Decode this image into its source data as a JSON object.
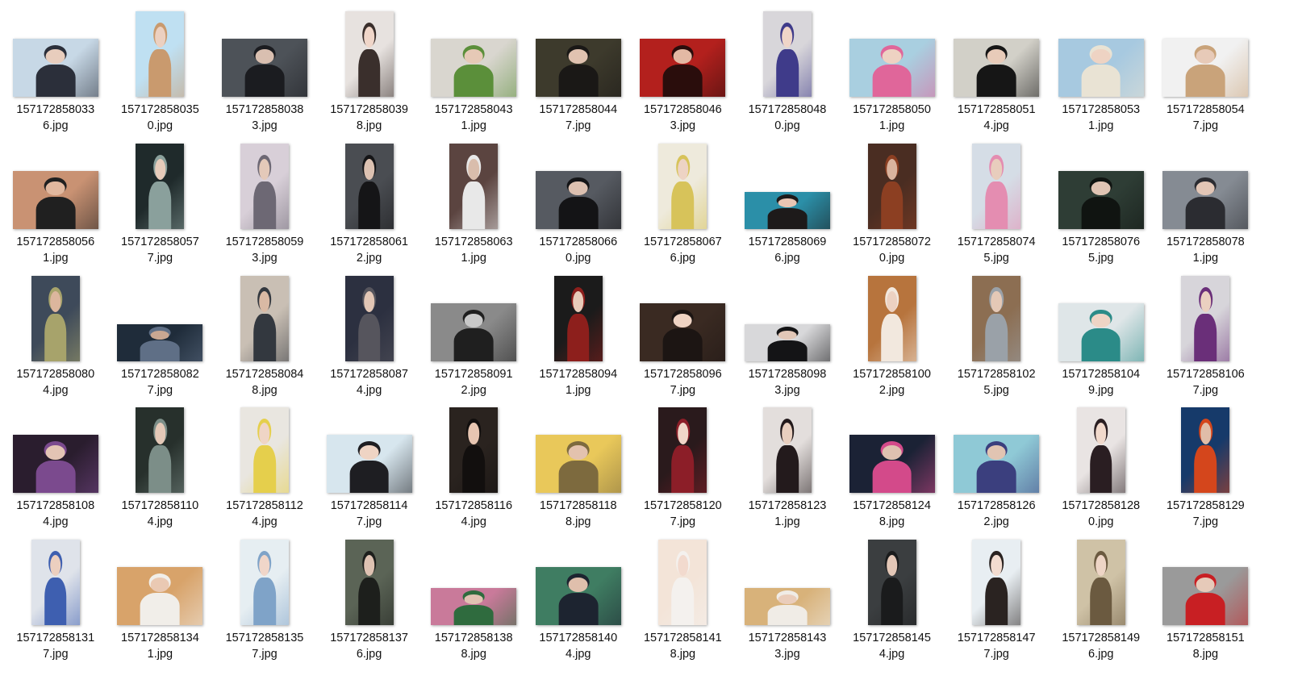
{
  "files": [
    {
      "name_line1": "157172858033",
      "name_line2": "6.jpg",
      "orient": "land",
      "bg": "#c7d8e6",
      "fg": "#2b2f3a",
      "skin": "#e8cdbd"
    },
    {
      "name_line1": "157172858035",
      "name_line2": "0.jpg",
      "orient": "port",
      "bg": "#bfe0f2",
      "fg": "#c99a6e",
      "skin": "#ecd0c0"
    },
    {
      "name_line1": "157172858038",
      "name_line2": "3.jpg",
      "orient": "land",
      "bg": "#4d5258",
      "fg": "#1b1c20",
      "skin": "#d9bfb0"
    },
    {
      "name_line1": "157172858039",
      "name_line2": "8.jpg",
      "orient": "port",
      "bg": "#e7e2df",
      "fg": "#3a2f2c",
      "skin": "#f0d6c9"
    },
    {
      "name_line1": "157172858043",
      "name_line2": "1.jpg",
      "orient": "land",
      "bg": "#d9d6cf",
      "fg": "#5b8f3a",
      "skin": "#e6c9b6"
    },
    {
      "name_line1": "157172858044",
      "name_line2": "7.jpg",
      "orient": "land",
      "bg": "#3d3a2c",
      "fg": "#1a1816",
      "skin": "#e0c2b0"
    },
    {
      "name_line1": "157172858046",
      "name_line2": "3.jpg",
      "orient": "land",
      "bg": "#b3201d",
      "fg": "#2a0d0c",
      "skin": "#e3b9a4"
    },
    {
      "name_line1": "157172858048",
      "name_line2": "0.jpg",
      "orient": "port",
      "bg": "#d8d6da",
      "fg": "#3f3b8a",
      "skin": "#efd5c8"
    },
    {
      "name_line1": "157172858050",
      "name_line2": "1.jpg",
      "orient": "land",
      "bg": "#a9cfe0",
      "fg": "#e0669a",
      "skin": "#eed2c2"
    },
    {
      "name_line1": "157172858051",
      "name_line2": "4.jpg",
      "orient": "land",
      "bg": "#d2d0c8",
      "fg": "#161616",
      "skin": "#e8cbb9"
    },
    {
      "name_line1": "157172858053",
      "name_line2": "1.jpg",
      "orient": "land",
      "bg": "#a7c9e0",
      "fg": "#e9e3d4",
      "skin": "#eed3c3"
    },
    {
      "name_line1": "157172858054",
      "name_line2": "7.jpg",
      "orient": "land",
      "bg": "#f1f1f1",
      "fg": "#c9a37a",
      "skin": "#e7cab8"
    },
    {
      "name_line1": "157172858056",
      "name_line2": "1.jpg",
      "orient": "land",
      "bg": "#c99273",
      "fg": "#202020",
      "skin": "#e1b89f"
    },
    {
      "name_line1": "157172858057",
      "name_line2": "7.jpg",
      "orient": "port",
      "bg": "#1f2a2b",
      "fg": "#8aa09c",
      "skin": "#e6cbba"
    },
    {
      "name_line1": "157172858059",
      "name_line2": "3.jpg",
      "orient": "port",
      "bg": "#d8cfd8",
      "fg": "#6d6874",
      "skin": "#e4c9b9"
    },
    {
      "name_line1": "157172858061",
      "name_line2": "2.jpg",
      "orient": "port",
      "bg": "#4a4d52",
      "fg": "#151517",
      "skin": "#dcc1b1"
    },
    {
      "name_line1": "157172858063",
      "name_line2": "1.jpg",
      "orient": "port",
      "bg": "#5b4440",
      "fg": "#e8e8e8",
      "skin": "#d9bdac"
    },
    {
      "name_line1": "157172858066",
      "name_line2": "0.jpg",
      "orient": "land",
      "bg": "#565a61",
      "fg": "#141416",
      "skin": "#dcc0b0"
    },
    {
      "name_line1": "157172858067",
      "name_line2": "6.jpg",
      "orient": "port",
      "bg": "#eeeadc",
      "fg": "#d7c35a",
      "skin": "#edd3c4"
    },
    {
      "name_line1": "157172858069",
      "name_line2": "6.jpg",
      "orient": "wide",
      "bg": "#2b8fa8",
      "fg": "#1d1a1a",
      "skin": "#e9c5b3"
    },
    {
      "name_line1": "157172858072",
      "name_line2": "0.jpg",
      "orient": "port",
      "bg": "#4a2d22",
      "fg": "#8c3f22",
      "skin": "#d9b39e"
    },
    {
      "name_line1": "157172858074",
      "name_line2": "5.jpg",
      "orient": "port",
      "bg": "#d5dde6",
      "fg": "#e48db1",
      "skin": "#e8cdbd"
    },
    {
      "name_line1": "157172858076",
      "name_line2": "5.jpg",
      "orient": "land",
      "bg": "#2e3d35",
      "fg": "#101411",
      "skin": "#e0c4b3"
    },
    {
      "name_line1": "157172858078",
      "name_line2": "1.jpg",
      "orient": "land",
      "bg": "#858b93",
      "fg": "#2b2c31",
      "skin": "#e2c6b6"
    },
    {
      "name_line1": "157172858080",
      "name_line2": "4.jpg",
      "orient": "port",
      "bg": "#3e4a5a",
      "fg": "#a7a36b",
      "skin": "#dcb69d"
    },
    {
      "name_line1": "157172858082",
      "name_line2": "7.jpg",
      "orient": "wide",
      "bg": "#1f2c3a",
      "fg": "#5f6f86",
      "skin": "#c9a792"
    },
    {
      "name_line1": "157172858084",
      "name_line2": "8.jpg",
      "orient": "port",
      "bg": "#c9bfb4",
      "fg": "#33383f",
      "skin": "#d9b9a4"
    },
    {
      "name_line1": "157172858087",
      "name_line2": "4.jpg",
      "orient": "port",
      "bg": "#2c3040",
      "fg": "#56555d",
      "skin": "#e2c6b5"
    },
    {
      "name_line1": "157172858091",
      "name_line2": "2.jpg",
      "orient": "land",
      "bg": "#8a8a8a",
      "fg": "#1f1f1f",
      "skin": "#c8c8c8"
    },
    {
      "name_line1": "157172858094",
      "name_line2": "1.jpg",
      "orient": "port",
      "bg": "#1b1b1b",
      "fg": "#8d1f1c",
      "skin": "#e8cbb9"
    },
    {
      "name_line1": "157172858096",
      "name_line2": "7.jpg",
      "orient": "land",
      "bg": "#3a2a22",
      "fg": "#1c1513",
      "skin": "#efd3c3"
    },
    {
      "name_line1": "157172858098",
      "name_line2": "3.jpg",
      "orient": "wide",
      "bg": "#d8d8da",
      "fg": "#141416",
      "skin": "#e2c7b7"
    },
    {
      "name_line1": "157172858100",
      "name_line2": "2.jpg",
      "orient": "port",
      "bg": "#b7743d",
      "fg": "#f2e8de",
      "skin": "#ecd1c1"
    },
    {
      "name_line1": "157172858102",
      "name_line2": "5.jpg",
      "orient": "port",
      "bg": "#8c6e52",
      "fg": "#9aa1a8",
      "skin": "#e4c8b6"
    },
    {
      "name_line1": "157172858104",
      "name_line2": "9.jpg",
      "orient": "land",
      "bg": "#dfe6e8",
      "fg": "#2b8b88",
      "skin": "#eed4c5"
    },
    {
      "name_line1": "157172858106",
      "name_line2": "7.jpg",
      "orient": "port",
      "bg": "#d7d5da",
      "fg": "#6a2f79",
      "skin": "#ebd0c0"
    },
    {
      "name_line1": "157172858108",
      "name_line2": "4.jpg",
      "orient": "land",
      "bg": "#2a1d2e",
      "fg": "#7b4a8e",
      "skin": "#e3c4b4"
    },
    {
      "name_line1": "157172858110",
      "name_line2": "4.jpg",
      "orient": "port",
      "bg": "#27302c",
      "fg": "#7c8e88",
      "skin": "#e4c8b7"
    },
    {
      "name_line1": "157172858112",
      "name_line2": "4.jpg",
      "orient": "port",
      "bg": "#e9e6e0",
      "fg": "#e5cf4c",
      "skin": "#efd5c6"
    },
    {
      "name_line1": "157172858114",
      "name_line2": "7.jpg",
      "orient": "land",
      "bg": "#d7e6ee",
      "fg": "#1e1e22",
      "skin": "#efd4c4"
    },
    {
      "name_line1": "157172858116",
      "name_line2": "4.jpg",
      "orient": "port",
      "bg": "#2a231f",
      "fg": "#120f0e",
      "skin": "#e7c5b1"
    },
    {
      "name_line1": "157172858118",
      "name_line2": "8.jpg",
      "orient": "land",
      "bg": "#e9c85a",
      "fg": "#7d6a3e",
      "skin": "#e3c2ae"
    },
    {
      "name_line1": "157172858120",
      "name_line2": "7.jpg",
      "orient": "port",
      "bg": "#2a1a1c",
      "fg": "#8c1e28",
      "skin": "#f0d6c8"
    },
    {
      "name_line1": "157172858123",
      "name_line2": "1.jpg",
      "orient": "port",
      "bg": "#e3dedc",
      "fg": "#231a1c",
      "skin": "#e9cfbf"
    },
    {
      "name_line1": "157172858124",
      "name_line2": "8.jpg",
      "orient": "land",
      "bg": "#1b2235",
      "fg": "#d34a8a",
      "skin": "#dec1b0"
    },
    {
      "name_line1": "157172858126",
      "name_line2": "2.jpg",
      "orient": "land",
      "bg": "#8fc9d6",
      "fg": "#3b3f7e",
      "skin": "#e1c4b2"
    },
    {
      "name_line1": "157172858128",
      "name_line2": "0.jpg",
      "orient": "port",
      "bg": "#e9e4e3",
      "fg": "#2a1e22",
      "skin": "#f1d9cc"
    },
    {
      "name_line1": "157172858129",
      "name_line2": "7.jpg",
      "orient": "port",
      "bg": "#163a6a",
      "fg": "#d4461c",
      "skin": "#e0bda8"
    },
    {
      "name_line1": "157172858131",
      "name_line2": "7.jpg",
      "orient": "port",
      "bg": "#dfe3ea",
      "fg": "#3e5fb0",
      "skin": "#eccfbf"
    },
    {
      "name_line1": "157172858134",
      "name_line2": "1.jpg",
      "orient": "land",
      "bg": "#d8a36a",
      "fg": "#f1eee9",
      "skin": "#eac9b3"
    },
    {
      "name_line1": "157172858135",
      "name_line2": "7.jpg",
      "orient": "port",
      "bg": "#e6eef2",
      "fg": "#7fa3c8",
      "skin": "#f0d6c9"
    },
    {
      "name_line1": "157172858137",
      "name_line2": "6.jpg",
      "orient": "port",
      "bg": "#5b6456",
      "fg": "#1d1f1c",
      "skin": "#dec2b2"
    },
    {
      "name_line1": "157172858138",
      "name_line2": "8.jpg",
      "orient": "wide",
      "bg": "#c97a9a",
      "fg": "#2f6b3e",
      "skin": "#e1c2b2"
    },
    {
      "name_line1": "157172858140",
      "name_line2": "4.jpg",
      "orient": "land",
      "bg": "#3f7d62",
      "fg": "#1d2430",
      "skin": "#dfbfac"
    },
    {
      "name_line1": "157172858141",
      "name_line2": "8.jpg",
      "orient": "port",
      "bg": "#f3e4d8",
      "fg": "#f4f1ee",
      "skin": "#f2dace"
    },
    {
      "name_line1": "157172858143",
      "name_line2": "3.jpg",
      "orient": "wide",
      "bg": "#d8b27a",
      "fg": "#f0ece6",
      "skin": "#eacdbb"
    },
    {
      "name_line1": "157172858145",
      "name_line2": "4.jpg",
      "orient": "port",
      "bg": "#3b3e40",
      "fg": "#1a1b1c",
      "skin": "#e3c7b7"
    },
    {
      "name_line1": "157172858147",
      "name_line2": "7.jpg",
      "orient": "port",
      "bg": "#e8eef2",
      "fg": "#2a2321",
      "skin": "#f3dcd0"
    },
    {
      "name_line1": "157172858149",
      "name_line2": "6.jpg",
      "orient": "port",
      "bg": "#cfc2a6",
      "fg": "#6b5a40",
      "skin": "#eed5c6"
    },
    {
      "name_line1": "157172858151",
      "name_line2": "8.jpg",
      "orient": "land",
      "bg": "#9a9a9a",
      "fg": "#c81f23",
      "skin": "#e6cab9"
    }
  ]
}
